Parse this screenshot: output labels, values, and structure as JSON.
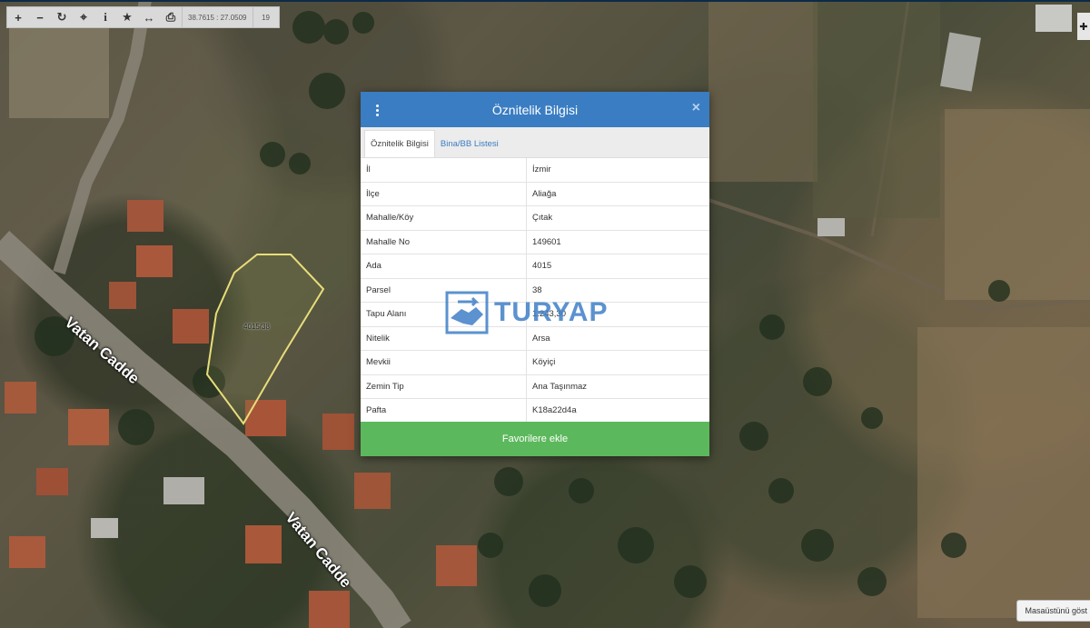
{
  "toolbar": {
    "buttons": [
      {
        "icon": "zoom-in-icon",
        "glyph": "+"
      },
      {
        "icon": "zoom-out-icon",
        "glyph": "−"
      },
      {
        "icon": "refresh-icon",
        "glyph": "↻"
      },
      {
        "icon": "locate-icon",
        "glyph": "⌖"
      },
      {
        "icon": "info-icon",
        "glyph": "i"
      },
      {
        "icon": "star-icon",
        "glyph": "★"
      },
      {
        "icon": "measure-icon",
        "glyph": "↔"
      },
      {
        "icon": "print-icon",
        "glyph": "⎙"
      }
    ],
    "coordinates": "38.7615 : 27.0509",
    "zoom_level": "19"
  },
  "map": {
    "parcel_label": "4015/38",
    "road_label": "Vatan Cadde",
    "desktop_badge": "Masaüstünü göst"
  },
  "modal": {
    "title": "Öznitelik Bilgisi",
    "tabs": [
      "Öznitelik Bilgisi",
      "Bina/BB Listesi"
    ],
    "rows": [
      {
        "key": "İl",
        "value": "İzmir"
      },
      {
        "key": "İlçe",
        "value": "Aliağa"
      },
      {
        "key": "Mahalle/Köy",
        "value": "Çıtak"
      },
      {
        "key": "Mahalle No",
        "value": "149601"
      },
      {
        "key": "Ada",
        "value": "4015"
      },
      {
        "key": "Parsel",
        "value": "38"
      },
      {
        "key": "Tapu Alanı",
        "value": "1.243,30"
      },
      {
        "key": "Nitelik",
        "value": "Arsa"
      },
      {
        "key": "Mevkii",
        "value": "Köyiçi"
      },
      {
        "key": "Zemin Tip",
        "value": "Ana Taşınmaz"
      },
      {
        "key": "Pafta",
        "value": "K18a22d4a"
      }
    ],
    "favorite_button": "Favorilere ekle"
  },
  "watermark": {
    "text": "TURYAP"
  },
  "colors": {
    "header": "#3a7dc2",
    "favorite_button": "#5cb85c",
    "parcel_outline": "#e8dd7a"
  }
}
